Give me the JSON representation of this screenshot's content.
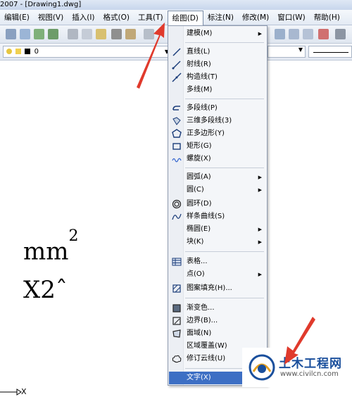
{
  "window": {
    "title": "2007 - [Drawing1.dwg]"
  },
  "menubar": {
    "items": [
      "编辑(E)",
      "视图(V)",
      "插入(I)",
      "格式(O)",
      "工具(T)",
      "绘图(D)",
      "标注(N)",
      "修改(M)",
      "窗口(W)",
      "帮助(H)"
    ],
    "active": "绘图(D)"
  },
  "layer_toolbar": {
    "layer_name": "0"
  },
  "draw_menu": {
    "items": [
      {
        "label": "建模(M)",
        "submenu": true
      },
      {
        "label": "直线(L)"
      },
      {
        "label": "射线(R)"
      },
      {
        "label": "构造线(T)"
      },
      {
        "label": "多线(M)"
      },
      {
        "label": "多段线(P)"
      },
      {
        "label": "三维多段线(3)"
      },
      {
        "label": "正多边形(Y)"
      },
      {
        "label": "矩形(G)"
      },
      {
        "label": "螺旋(X)"
      },
      {
        "label": "圆弧(A)",
        "submenu": true
      },
      {
        "label": "圆(C)",
        "submenu": true
      },
      {
        "label": "圆环(D)"
      },
      {
        "label": "样条曲线(S)"
      },
      {
        "label": "椭圆(E)",
        "submenu": true
      },
      {
        "label": "块(K)",
        "submenu": true
      },
      {
        "label": "表格..."
      },
      {
        "label": "点(O)",
        "submenu": true
      },
      {
        "label": "图案填充(H)..."
      },
      {
        "label": "渐变色..."
      },
      {
        "label": "边界(B)..."
      },
      {
        "label": "面域(N)"
      },
      {
        "label": "区域覆盖(W)"
      },
      {
        "label": "修订云线(U)"
      },
      {
        "label": "文字(X)",
        "highlighted": true
      }
    ]
  },
  "canvas": {
    "text_mm": "mm",
    "text_mm_sup": "2",
    "text_x2": "X2ˆ",
    "axis_label": "X"
  },
  "watermark": {
    "title": "土木工程网",
    "url": "www.civilcn.com"
  },
  "colors": {
    "menu_highlight": "#3d6fc4",
    "arrow_red": "#e03a2c",
    "watermark_blue": "#1a4f9c"
  }
}
